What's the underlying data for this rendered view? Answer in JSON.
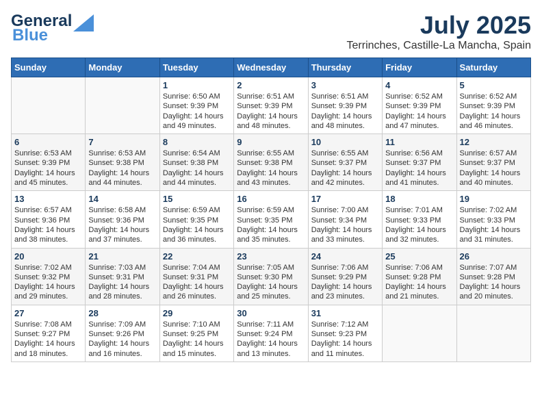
{
  "logo": {
    "line1": "General",
    "line2": "Blue"
  },
  "title": "July 2025",
  "location": "Terrinches, Castille-La Mancha, Spain",
  "days_header": [
    "Sunday",
    "Monday",
    "Tuesday",
    "Wednesday",
    "Thursday",
    "Friday",
    "Saturday"
  ],
  "weeks": [
    [
      {
        "day": "",
        "info": ""
      },
      {
        "day": "",
        "info": ""
      },
      {
        "day": "1",
        "info": "Sunrise: 6:50 AM\nSunset: 9:39 PM\nDaylight: 14 hours and 49 minutes."
      },
      {
        "day": "2",
        "info": "Sunrise: 6:51 AM\nSunset: 9:39 PM\nDaylight: 14 hours and 48 minutes."
      },
      {
        "day": "3",
        "info": "Sunrise: 6:51 AM\nSunset: 9:39 PM\nDaylight: 14 hours and 48 minutes."
      },
      {
        "day": "4",
        "info": "Sunrise: 6:52 AM\nSunset: 9:39 PM\nDaylight: 14 hours and 47 minutes."
      },
      {
        "day": "5",
        "info": "Sunrise: 6:52 AM\nSunset: 9:39 PM\nDaylight: 14 hours and 46 minutes."
      }
    ],
    [
      {
        "day": "6",
        "info": "Sunrise: 6:53 AM\nSunset: 9:39 PM\nDaylight: 14 hours and 45 minutes."
      },
      {
        "day": "7",
        "info": "Sunrise: 6:53 AM\nSunset: 9:38 PM\nDaylight: 14 hours and 44 minutes."
      },
      {
        "day": "8",
        "info": "Sunrise: 6:54 AM\nSunset: 9:38 PM\nDaylight: 14 hours and 44 minutes."
      },
      {
        "day": "9",
        "info": "Sunrise: 6:55 AM\nSunset: 9:38 PM\nDaylight: 14 hours and 43 minutes."
      },
      {
        "day": "10",
        "info": "Sunrise: 6:55 AM\nSunset: 9:37 PM\nDaylight: 14 hours and 42 minutes."
      },
      {
        "day": "11",
        "info": "Sunrise: 6:56 AM\nSunset: 9:37 PM\nDaylight: 14 hours and 41 minutes."
      },
      {
        "day": "12",
        "info": "Sunrise: 6:57 AM\nSunset: 9:37 PM\nDaylight: 14 hours and 40 minutes."
      }
    ],
    [
      {
        "day": "13",
        "info": "Sunrise: 6:57 AM\nSunset: 9:36 PM\nDaylight: 14 hours and 38 minutes."
      },
      {
        "day": "14",
        "info": "Sunrise: 6:58 AM\nSunset: 9:36 PM\nDaylight: 14 hours and 37 minutes."
      },
      {
        "day": "15",
        "info": "Sunrise: 6:59 AM\nSunset: 9:35 PM\nDaylight: 14 hours and 36 minutes."
      },
      {
        "day": "16",
        "info": "Sunrise: 6:59 AM\nSunset: 9:35 PM\nDaylight: 14 hours and 35 minutes."
      },
      {
        "day": "17",
        "info": "Sunrise: 7:00 AM\nSunset: 9:34 PM\nDaylight: 14 hours and 33 minutes."
      },
      {
        "day": "18",
        "info": "Sunrise: 7:01 AM\nSunset: 9:33 PM\nDaylight: 14 hours and 32 minutes."
      },
      {
        "day": "19",
        "info": "Sunrise: 7:02 AM\nSunset: 9:33 PM\nDaylight: 14 hours and 31 minutes."
      }
    ],
    [
      {
        "day": "20",
        "info": "Sunrise: 7:02 AM\nSunset: 9:32 PM\nDaylight: 14 hours and 29 minutes."
      },
      {
        "day": "21",
        "info": "Sunrise: 7:03 AM\nSunset: 9:31 PM\nDaylight: 14 hours and 28 minutes."
      },
      {
        "day": "22",
        "info": "Sunrise: 7:04 AM\nSunset: 9:31 PM\nDaylight: 14 hours and 26 minutes."
      },
      {
        "day": "23",
        "info": "Sunrise: 7:05 AM\nSunset: 9:30 PM\nDaylight: 14 hours and 25 minutes."
      },
      {
        "day": "24",
        "info": "Sunrise: 7:06 AM\nSunset: 9:29 PM\nDaylight: 14 hours and 23 minutes."
      },
      {
        "day": "25",
        "info": "Sunrise: 7:06 AM\nSunset: 9:28 PM\nDaylight: 14 hours and 21 minutes."
      },
      {
        "day": "26",
        "info": "Sunrise: 7:07 AM\nSunset: 9:28 PM\nDaylight: 14 hours and 20 minutes."
      }
    ],
    [
      {
        "day": "27",
        "info": "Sunrise: 7:08 AM\nSunset: 9:27 PM\nDaylight: 14 hours and 18 minutes."
      },
      {
        "day": "28",
        "info": "Sunrise: 7:09 AM\nSunset: 9:26 PM\nDaylight: 14 hours and 16 minutes."
      },
      {
        "day": "29",
        "info": "Sunrise: 7:10 AM\nSunset: 9:25 PM\nDaylight: 14 hours and 15 minutes."
      },
      {
        "day": "30",
        "info": "Sunrise: 7:11 AM\nSunset: 9:24 PM\nDaylight: 14 hours and 13 minutes."
      },
      {
        "day": "31",
        "info": "Sunrise: 7:12 AM\nSunset: 9:23 PM\nDaylight: 14 hours and 11 minutes."
      },
      {
        "day": "",
        "info": ""
      },
      {
        "day": "",
        "info": ""
      }
    ]
  ]
}
